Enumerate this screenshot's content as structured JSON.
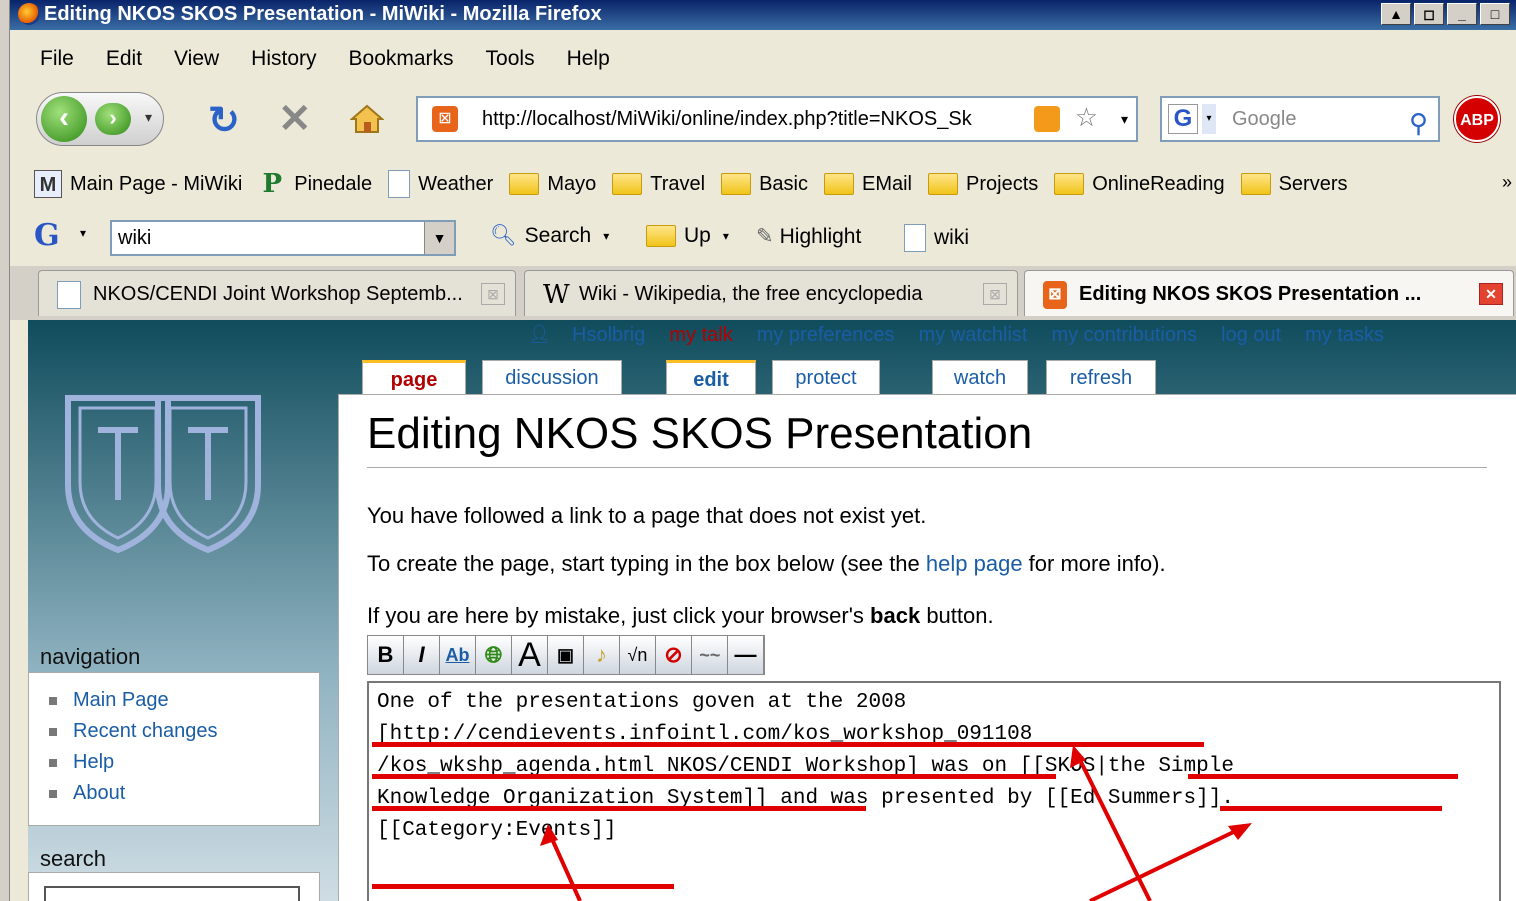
{
  "window": {
    "title": "Editing NKOS SKOS Presentation - MiWiki - Mozilla Firefox",
    "buttons": [
      "▲",
      "◻",
      "_",
      "□"
    ]
  },
  "menu": [
    "File",
    "Edit",
    "View",
    "History",
    "Bookmarks",
    "Tools",
    "Help"
  ],
  "nav": {
    "url": "http://localhost/MiWiki/online/index.php?title=NKOS_Sk",
    "search_placeholder": "Google",
    "abp": "ABP"
  },
  "bookmarks": [
    {
      "label": "Main Page - MiWiki",
      "icon": "M"
    },
    {
      "label": "Pinedale",
      "icon": "P"
    },
    {
      "label": "Weather",
      "icon": "page"
    },
    {
      "label": "Mayo",
      "icon": "folder"
    },
    {
      "label": "Travel",
      "icon": "folder"
    },
    {
      "label": "Basic",
      "icon": "folder"
    },
    {
      "label": "EMail",
      "icon": "folder"
    },
    {
      "label": "Projects",
      "icon": "folder"
    },
    {
      "label": "OnlineReading",
      "icon": "folder"
    },
    {
      "label": "Servers",
      "icon": "folder"
    }
  ],
  "toolbar2": {
    "logo": "G",
    "input": "wiki",
    "search": "Search",
    "up": "Up",
    "highlight": "Highlight",
    "wiki": "wiki"
  },
  "tabs": [
    {
      "label": "NKOS/CENDI Joint Workshop Septemb..."
    },
    {
      "label": "Wiki - Wikipedia, the free encyclopedia"
    },
    {
      "label": "Editing NKOS SKOS Presentation ..."
    }
  ],
  "userbar": {
    "user": "Hsolbrig",
    "talk": "my talk",
    "prefs": "my preferences",
    "watchlist": "my watchlist",
    "contribs": "my contributions",
    "logout": "log out",
    "tasks": "my tasks"
  },
  "page_tabs": [
    "page",
    "discussion",
    "edit",
    "protect",
    "watch",
    "refresh"
  ],
  "sidebar": {
    "nav_heading": "navigation",
    "nav_items": [
      "Main Page",
      "Recent changes",
      "Help",
      "About"
    ],
    "search_heading": "search"
  },
  "content": {
    "title": "Editing NKOS SKOS Presentation",
    "p1": "You have followed a link to a page that does not exist yet.",
    "p2_pre": "To create the page, start typing in the box below (see the ",
    "p2_link": "help page",
    "p2_post": " for more info).",
    "p3_pre": "If you are here by mistake, just click your browser's ",
    "p3_bold": "back",
    "p3_post": " button.",
    "textarea_lines": [
      "One of the presentations goven at the 2008",
      "[http://cendievents.infointl.com/kos_workshop_091108",
      "/kos_wkshp_agenda.html NKOS/CENDI Workshop] was on [[SKOS|the Simple",
      "Knowledge Organization System]] and was presented by [[Ed Summers]].",
      "",
      "[[Category:Events]]"
    ]
  },
  "colors": {
    "wiki_bg": "#0f4c5c",
    "link": "#1a5da5",
    "annotation": "#e00000",
    "firefox_orange": "#e8641b"
  }
}
